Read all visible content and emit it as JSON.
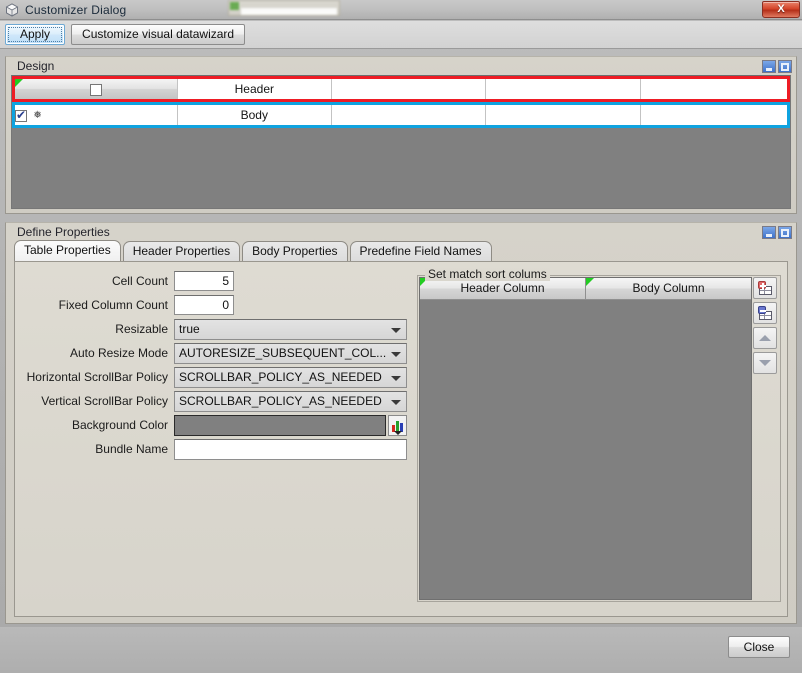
{
  "window": {
    "title": "Customizer Dialog",
    "icon": "cube-icon",
    "close_label": "X"
  },
  "toolbar": {
    "apply_label": "Apply",
    "customize_label": "Customize visual datawizard"
  },
  "design_panel": {
    "title": "Design",
    "minimize_icon": "minimize-icon",
    "maximize_icon": "maximize-icon",
    "columns": [
      "",
      "",
      "",
      "",
      ""
    ],
    "rows": [
      {
        "name": "header-row",
        "checkbox": false,
        "label": "Header",
        "selection_color": "#ee1c25"
      },
      {
        "name": "body-row",
        "checkbox": true,
        "label": "Body",
        "glyph": "❅",
        "selection_color": "#0fa3e0"
      }
    ]
  },
  "define_panel": {
    "title": "Define Properties",
    "minimize_icon": "minimize-icon",
    "maximize_icon": "maximize-icon",
    "tabs": [
      {
        "label": "Table Properties",
        "active": true
      },
      {
        "label": "Header Properties",
        "active": false
      },
      {
        "label": "Body Properties",
        "active": false
      },
      {
        "label": "Predefine Field Names",
        "active": false
      }
    ],
    "form": {
      "cell_count": {
        "label": "Cell Count",
        "value": "5"
      },
      "fixed_column_count": {
        "label": "Fixed Column Count",
        "value": "0"
      },
      "resizable": {
        "label": "Resizable",
        "value": "true"
      },
      "auto_resize_mode": {
        "label": "Auto Resize Mode",
        "value": "AUTORESIZE_SUBSEQUENT_COL..."
      },
      "horizontal_scrollbar_policy": {
        "label": "Horizontal ScrollBar Policy",
        "value": "SCROLLBAR_POLICY_AS_NEEDED"
      },
      "vertical_scrollbar_policy": {
        "label": "Vertical ScrollBar Policy",
        "value": "SCROLLBAR_POLICY_AS_NEEDED"
      },
      "background_color": {
        "label": "Background Color",
        "value": "#808080",
        "picker_icon": "color-picker-icon"
      },
      "bundle_name": {
        "label": "Bundle Name",
        "value": "",
        "placeholder": ""
      }
    },
    "sort_columns": {
      "title": "Set match sort colums",
      "headers": [
        "Header Column",
        "Body Column"
      ],
      "rows": [],
      "buttons": [
        {
          "name": "add-row-button",
          "icon": "table-add-icon"
        },
        {
          "name": "remove-row-button",
          "icon": "table-remove-icon"
        },
        {
          "name": "move-up-button",
          "icon": "chevron-up-icon"
        },
        {
          "name": "move-down-button",
          "icon": "chevron-down-icon"
        }
      ]
    }
  },
  "footer": {
    "close_label": "Close"
  }
}
